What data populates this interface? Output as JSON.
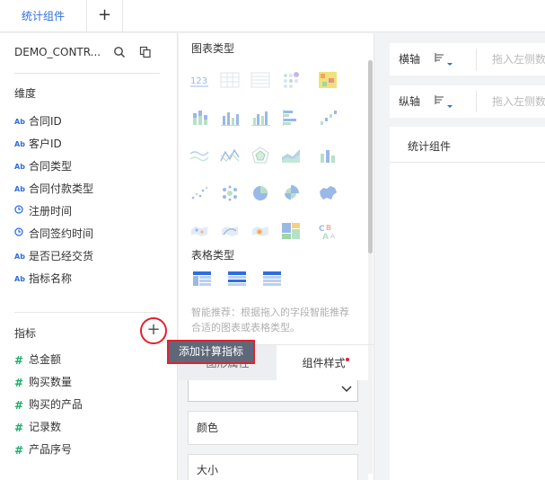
{
  "tabs": {
    "active_label": "统计组件",
    "add_label": "+"
  },
  "left": {
    "dataset_name": "DEMO_CONTR...",
    "dimension_title": "维度",
    "dimensions": [
      {
        "label": "合同ID",
        "type": "Ab"
      },
      {
        "label": "客户ID",
        "type": "Ab"
      },
      {
        "label": "合同类型",
        "type": "Ab"
      },
      {
        "label": "合同付款类型",
        "type": "Ab"
      },
      {
        "label": "注册时间",
        "type": "clock"
      },
      {
        "label": "合同签约时间",
        "type": "clock"
      },
      {
        "label": "是否已经交货",
        "type": "Ab"
      },
      {
        "label": "指标名称",
        "type": "Ab"
      }
    ],
    "metric_title": "指标",
    "add_metric_label": "+",
    "metrics": [
      {
        "label": "总金额",
        "type": "#"
      },
      {
        "label": "购买数量",
        "type": "#"
      },
      {
        "label": "购买的产品",
        "type": "#"
      },
      {
        "label": "记录数",
        "type": "#"
      },
      {
        "label": "产品序号",
        "type": "#"
      }
    ]
  },
  "middle": {
    "chart_type_title": "图表类型",
    "table_type_title": "表格类型",
    "hint": "智能推荐：根据拖入的字段智能推荐合适的图表或表格类型。",
    "tab_graph_attr": "图形属性",
    "tab_component_style": "组件样式",
    "color_label": "颜色",
    "size_label": "大小"
  },
  "tooltip": {
    "text": "添加计算指标"
  },
  "right": {
    "x_axis_label": "横轴",
    "y_axis_label": "纵轴",
    "axis_placeholder": "拖入左侧数据",
    "canvas_title": "统计组件"
  },
  "colors": {
    "accent": "#2f6ede",
    "metric": "#1dab6b",
    "highlight": "#e3212e"
  }
}
